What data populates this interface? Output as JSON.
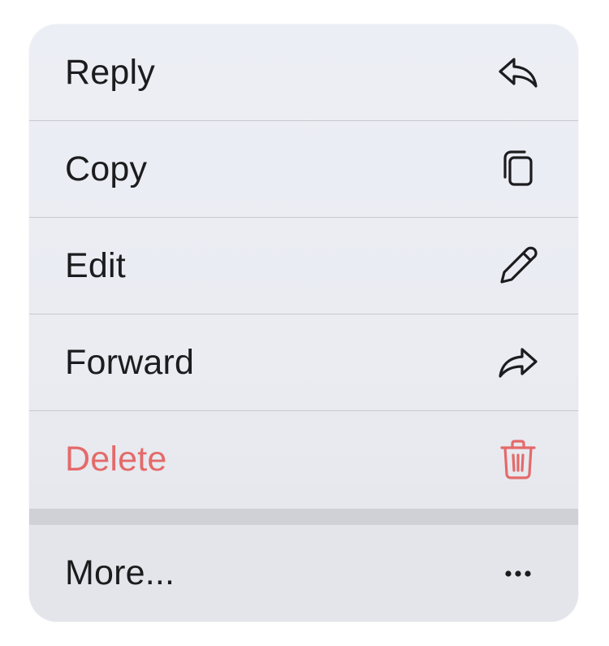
{
  "menu": {
    "items": [
      {
        "label": "Reply",
        "icon": "reply-icon"
      },
      {
        "label": "Copy",
        "icon": "copy-icon"
      },
      {
        "label": "Edit",
        "icon": "pencil-icon"
      },
      {
        "label": "Forward",
        "icon": "forward-icon"
      },
      {
        "label": "Delete",
        "icon": "trash-icon",
        "color": "#e46a6a"
      }
    ],
    "more": {
      "label": "More...",
      "icon": "ellipsis-icon"
    }
  }
}
